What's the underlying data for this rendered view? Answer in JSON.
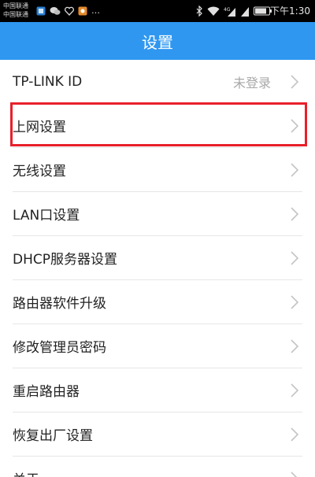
{
  "status_bar": {
    "carrier_1": "中国联通",
    "carrier_2": "中国联通",
    "dots": "…",
    "time": "下午1:30",
    "icons_left": [
      "notification-icon",
      "chat-icon",
      "heart-icon",
      "app-icon"
    ],
    "icons_right": [
      "bluetooth-icon",
      "wifi-icon",
      "signal-4g-icon",
      "signal-icon",
      "battery-icon"
    ]
  },
  "header": {
    "title": "设置"
  },
  "menu": {
    "items": [
      {
        "label": "TP-LINK ID",
        "value": "未登录"
      },
      {
        "label": "上网设置",
        "value": ""
      },
      {
        "label": "无线设置",
        "value": ""
      },
      {
        "label": "LAN口设置",
        "value": ""
      },
      {
        "label": "DHCP服务器设置",
        "value": ""
      },
      {
        "label": "路由器软件升级",
        "value": ""
      },
      {
        "label": "修改管理员密码",
        "value": ""
      },
      {
        "label": "重启路由器",
        "value": ""
      },
      {
        "label": "恢复出厂设置",
        "value": ""
      },
      {
        "label": "关于",
        "value": ""
      }
    ]
  },
  "highlight": {
    "target": "上网设置",
    "color": "#e8202a"
  },
  "colors": {
    "title_bar": "#2f97f0",
    "status_bar": "#000000"
  }
}
